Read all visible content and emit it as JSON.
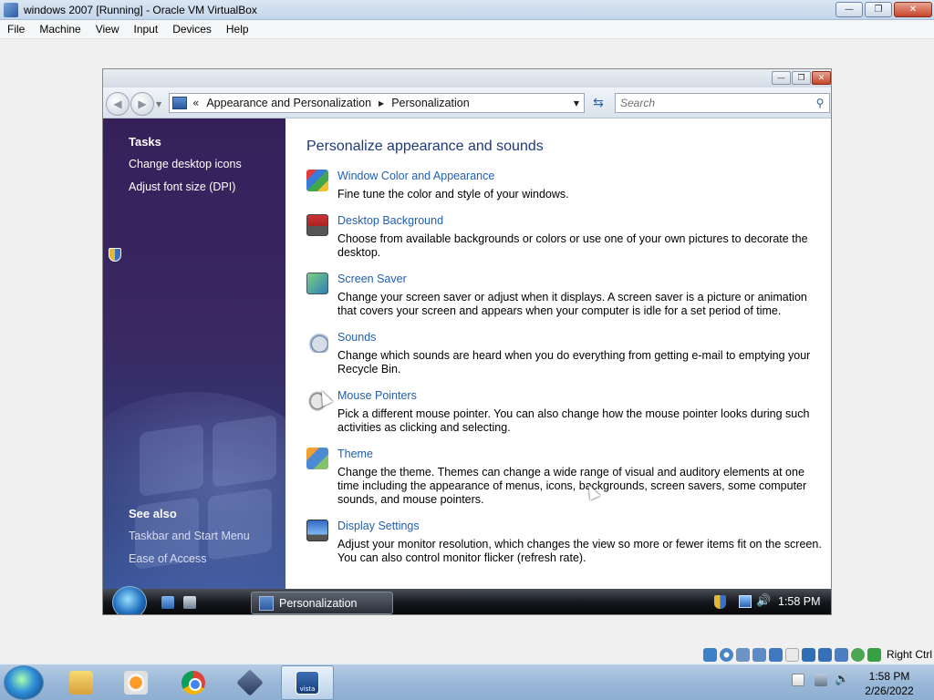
{
  "host": {
    "title": "windows 2007 [Running] - Oracle VM VirtualBox",
    "window_buttons": [
      "minimize",
      "restore",
      "close"
    ],
    "menu": [
      "File",
      "Machine",
      "View",
      "Input",
      "Devices",
      "Help"
    ],
    "status_bar": {
      "icons": [
        "hard-disk-icon",
        "optical-drive-icon",
        "audio-icon",
        "network-icon",
        "usb-icon",
        "shared-folders-icon",
        "display-icon",
        "video-capture-icon",
        "cpu-icon",
        "mouse-integration-icon",
        "keyboard-icon"
      ],
      "host_key_label": "Right Ctrl"
    },
    "taskbar": {
      "apps": [
        "windows-explorer",
        "windows-media-player",
        "google-chrome",
        "oracle-vm-virtualbox",
        "vista-vm"
      ],
      "active_app": "vista-vm",
      "vista_label": "vista",
      "clock": {
        "time": "1:58 PM",
        "date": "2/26/2022"
      }
    }
  },
  "guest": {
    "address_bar": {
      "overflow": "«",
      "crumbs": [
        "Appearance and Personalization",
        "Personalization"
      ]
    },
    "search_placeholder": "Search",
    "sidebar": {
      "tasks_heading": "Tasks",
      "tasks": [
        {
          "label": "Change desktop icons"
        },
        {
          "label": "Adjust font size (DPI)",
          "shield": true
        }
      ],
      "see_also_heading": "See also",
      "see_also": [
        "Taskbar and Start Menu",
        "Ease of Access"
      ]
    },
    "main": {
      "title": "Personalize appearance and sounds",
      "items": [
        {
          "link": "Window Color and Appearance",
          "desc": "Fine tune the color and style of your windows.",
          "icon": "window-color-icon"
        },
        {
          "link": "Desktop Background",
          "desc": "Choose from available backgrounds or colors or use one of your own pictures to decorate the desktop.",
          "icon": "desktop-background-icon"
        },
        {
          "link": "Screen Saver",
          "desc": "Change your screen saver or adjust when it displays. A screen saver is a picture or animation that covers your screen and appears when your computer is idle for a set period of time.",
          "icon": "screen-saver-icon"
        },
        {
          "link": "Sounds",
          "desc": "Change which sounds are heard when you do everything from getting e-mail to emptying your Recycle Bin.",
          "icon": "sounds-icon"
        },
        {
          "link": "Mouse Pointers",
          "desc": "Pick a different mouse pointer. You can also change how the mouse pointer looks during such activities as clicking and selecting.",
          "icon": "mouse-pointers-icon"
        },
        {
          "link": "Theme",
          "desc": "Change the theme. Themes can change a wide range of visual and auditory elements at one time including the appearance of menus, icons, backgrounds, screen savers, some computer sounds, and mouse pointers.",
          "icon": "theme-icon"
        },
        {
          "link": "Display Settings",
          "desc": "Adjust your monitor resolution, which changes the view so more or fewer items fit on the screen. You can also control monitor flicker (refresh rate).",
          "icon": "display-settings-icon"
        }
      ]
    },
    "taskbar": {
      "task_label": "Personalization",
      "clock": "1:58 PM"
    }
  }
}
